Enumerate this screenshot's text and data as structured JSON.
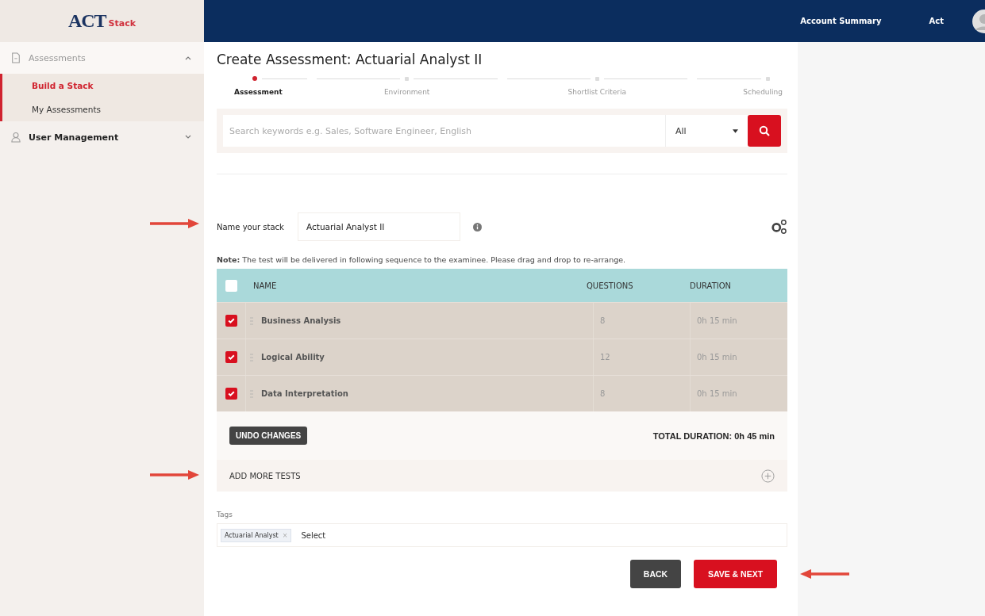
{
  "logo": {
    "brand": "ACT",
    "product": "Stack"
  },
  "top_nav": {
    "items": [
      "Account Summary",
      "Act"
    ]
  },
  "sidebar": {
    "items": [
      {
        "label": "Assessments",
        "expanded": true,
        "children": [
          {
            "label": "Build a Stack",
            "selected": true
          },
          {
            "label": "My Assessments",
            "selected": false
          }
        ]
      },
      {
        "label": "User Management",
        "expanded": false
      }
    ]
  },
  "page_title": "Create Assessment: Actuarial Analyst II",
  "stepper": [
    {
      "label": "Assessment",
      "selected": true
    },
    {
      "label": "Environment",
      "selected": false
    },
    {
      "label": "Shortlist Criteria",
      "selected": false
    },
    {
      "label": "Scheduling",
      "selected": false
    }
  ],
  "search": {
    "placeholder": "Search keywords e.g. Sales, Software Engineer, English",
    "category": "All"
  },
  "stack_name": {
    "label": "Name your stack",
    "value": "Actuarial Analyst II"
  },
  "note": "**Note:** The test will be delivered in following sequence to the examinee. Please drag and drop to re-arrange.",
  "table": {
    "select_all": false,
    "columns": [
      "NAME",
      "QUESTIONS",
      "DURATION"
    ],
    "rows": [
      {
        "checked": true,
        "name": "Business Analysis",
        "questions": "8",
        "duration": "0h 15 min"
      },
      {
        "checked": true,
        "name": "Logical Ability",
        "questions": "12",
        "duration": "0h 15 min"
      },
      {
        "checked": true,
        "name": "Data Interpretation",
        "questions": "8",
        "duration": "0h 15 min"
      }
    ]
  },
  "undo_button": "UNDO CHANGES",
  "total_duration": "TOTAL DURATION: 0h 45 min",
  "add_more": "ADD MORE TESTS",
  "tags": {
    "label": "Tags",
    "items": [
      "Actuarial Analyst"
    ],
    "remove": "×",
    "placeholder": "Select"
  },
  "buttons": {
    "back": "BACK",
    "next": "SAVE & NEXT"
  }
}
